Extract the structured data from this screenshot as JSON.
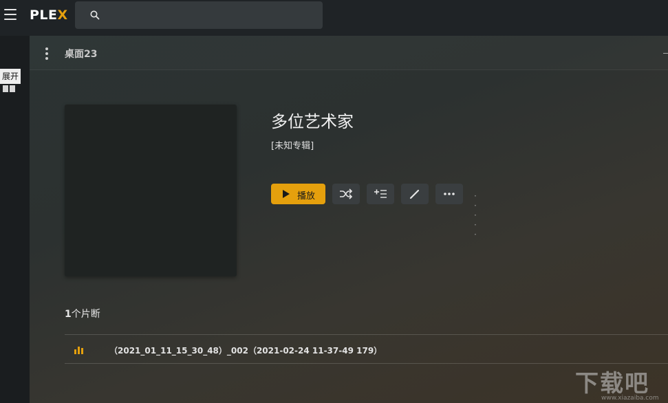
{
  "header": {
    "logo_prefix": "PLE",
    "logo_x": "X",
    "search_placeholder": ""
  },
  "sidebar": {
    "tooltip": "展开"
  },
  "subheader": {
    "breadcrumb": "桌面23"
  },
  "album": {
    "artist": "多位艺术家",
    "album_label": "[未知专辑]"
  },
  "actions": {
    "play_label": "播放",
    "more_dots": "· · · · ·"
  },
  "tracks": {
    "count_num": "1",
    "count_text": "个片断",
    "items": [
      {
        "title": "（2021_01_11_15_30_48）_002（2021-02-24 11-37-49 179）"
      }
    ]
  },
  "watermark": {
    "text": "下载吧",
    "url": "www.xiazaiba.com"
  },
  "colors": {
    "accent": "#e5a00d",
    "topbar": "#1f2326",
    "button": "#3a3e40"
  }
}
